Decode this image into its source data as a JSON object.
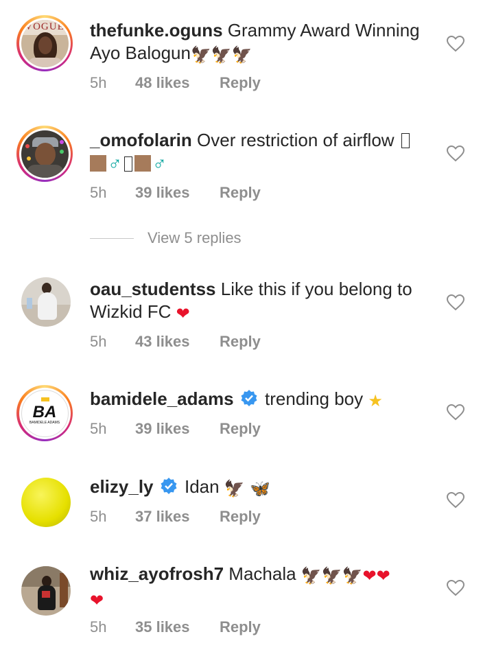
{
  "view_replies_label": "View 5 replies",
  "comments": [
    {
      "username": "thefunke.oguns",
      "text": "Grammy Award Winning Ayo Balogun",
      "emojis": "🦅🦅🦅",
      "time": "5h",
      "likes": "48 likes",
      "reply": "Reply",
      "verified": false,
      "story_ring": true,
      "avatar_text": "VOGUE"
    },
    {
      "username": "_omofolarin",
      "text": "Over restriction of airflow",
      "time": "5h",
      "likes": "39 likes",
      "reply": "Reply",
      "verified": false,
      "story_ring": true
    },
    {
      "username": "oau_studentss",
      "text": "Like this if you belong to Wizkid FC",
      "time": "5h",
      "likes": "43 likes",
      "reply": "Reply",
      "verified": false,
      "story_ring": false
    },
    {
      "username": "bamidele_adams",
      "text": "trending boy",
      "time": "5h",
      "likes": "39 likes",
      "reply": "Reply",
      "verified": true,
      "story_ring": true,
      "avatar_text": "BA",
      "avatar_subtext": "BAMIDELE ADAMS"
    },
    {
      "username": "elizy_ly",
      "text": "Idan",
      "time": "5h",
      "likes": "37 likes",
      "reply": "Reply",
      "verified": true,
      "story_ring": false
    },
    {
      "username": "whiz_ayofrosh7",
      "text": "Machala",
      "time": "5h",
      "likes": "35 likes",
      "reply": "Reply",
      "verified": false,
      "story_ring": false
    }
  ],
  "colors": {
    "text": "#262626",
    "meta": "#8e8e8e",
    "verified": "#3897f0",
    "heart_outline": "#8e8e8e"
  }
}
